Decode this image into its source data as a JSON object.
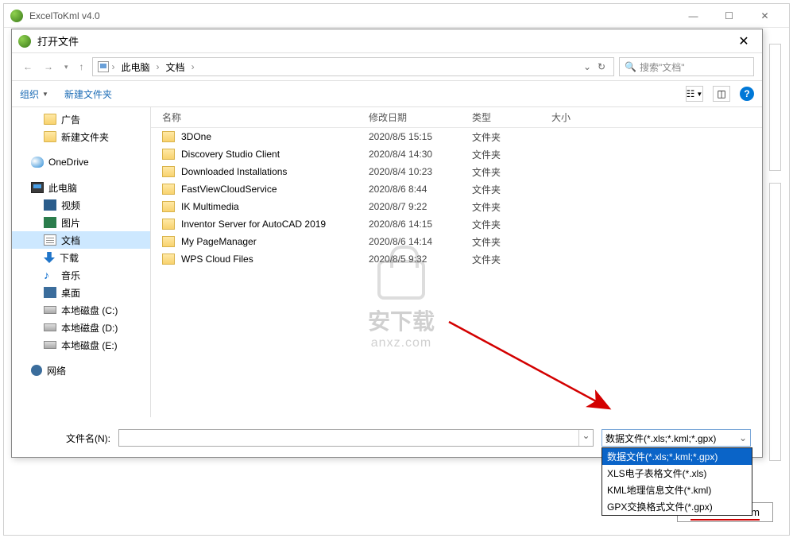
{
  "app": {
    "title": "ExcelToKml v4.0"
  },
  "dialog": {
    "title": "打开文件",
    "breadcrumb": {
      "thispc": "此电脑",
      "docs": "文档",
      "refresh_aria": "刷新"
    },
    "search_placeholder": "搜索\"文档\"",
    "toolbar": {
      "organize": "组织",
      "newfolder": "新建文件夹"
    },
    "columns": {
      "name": "名称",
      "date": "修改日期",
      "type": "类型",
      "size": "大小"
    },
    "filename_label": "文件名(N):",
    "filename_value": "",
    "filetype_selected": "数据文件(*.xls;*.kml;*.gpx)",
    "filetype_options": [
      "数据文件(*.xls;*.kml;*.gpx)",
      "XLS电子表格文件(*.xls)",
      "KML地理信息文件(*.kml)",
      "GPX交换格式文件(*.gpx)"
    ]
  },
  "tree": [
    {
      "icon": "folder",
      "label": "广告",
      "indent": true
    },
    {
      "icon": "folder",
      "label": "新建文件夹",
      "indent": true
    },
    {
      "icon": "onedrive",
      "label": "OneDrive",
      "indent": false,
      "gapTop": true
    },
    {
      "icon": "thispc",
      "label": "此电脑",
      "indent": false,
      "gapTop": true
    },
    {
      "icon": "video",
      "label": "视频",
      "indent": true
    },
    {
      "icon": "pictures",
      "label": "图片",
      "indent": true
    },
    {
      "icon": "docs",
      "label": "文档",
      "indent": true,
      "selected": true
    },
    {
      "icon": "downloads",
      "label": "下载",
      "indent": true
    },
    {
      "icon": "music",
      "label": "音乐",
      "indent": true,
      "glyph": "♪"
    },
    {
      "icon": "desktop",
      "label": "桌面",
      "indent": true
    },
    {
      "icon": "disk",
      "label": "本地磁盘 (C:)",
      "indent": true
    },
    {
      "icon": "disk",
      "label": "本地磁盘 (D:)",
      "indent": true
    },
    {
      "icon": "disk",
      "label": "本地磁盘 (E:)",
      "indent": true
    },
    {
      "icon": "network",
      "label": "网络",
      "indent": false,
      "gapTop": true
    }
  ],
  "files": [
    {
      "name": "3DOne",
      "date": "2020/8/5 15:15",
      "type": "文件夹"
    },
    {
      "name": "Discovery Studio Client",
      "date": "2020/8/4 14:30",
      "type": "文件夹"
    },
    {
      "name": "Downloaded Installations",
      "date": "2020/8/4 10:23",
      "type": "文件夹"
    },
    {
      "name": "FastViewCloudService",
      "date": "2020/8/6 8:44",
      "type": "文件夹"
    },
    {
      "name": "IK Multimedia",
      "date": "2020/8/7 9:22",
      "type": "文件夹"
    },
    {
      "name": "Inventor Server for AutoCAD 2019",
      "date": "2020/8/6 14:15",
      "type": "文件夹"
    },
    {
      "name": "My PageManager",
      "date": "2020/8/6 14:14",
      "type": "文件夹"
    },
    {
      "name": "WPS Cloud Files",
      "date": "2020/8/5 9:32",
      "type": "文件夹"
    }
  ],
  "watermark": {
    "big": "安下载",
    "small": "anxz.com"
  },
  "footer": {
    "link": "www.htine.com"
  }
}
